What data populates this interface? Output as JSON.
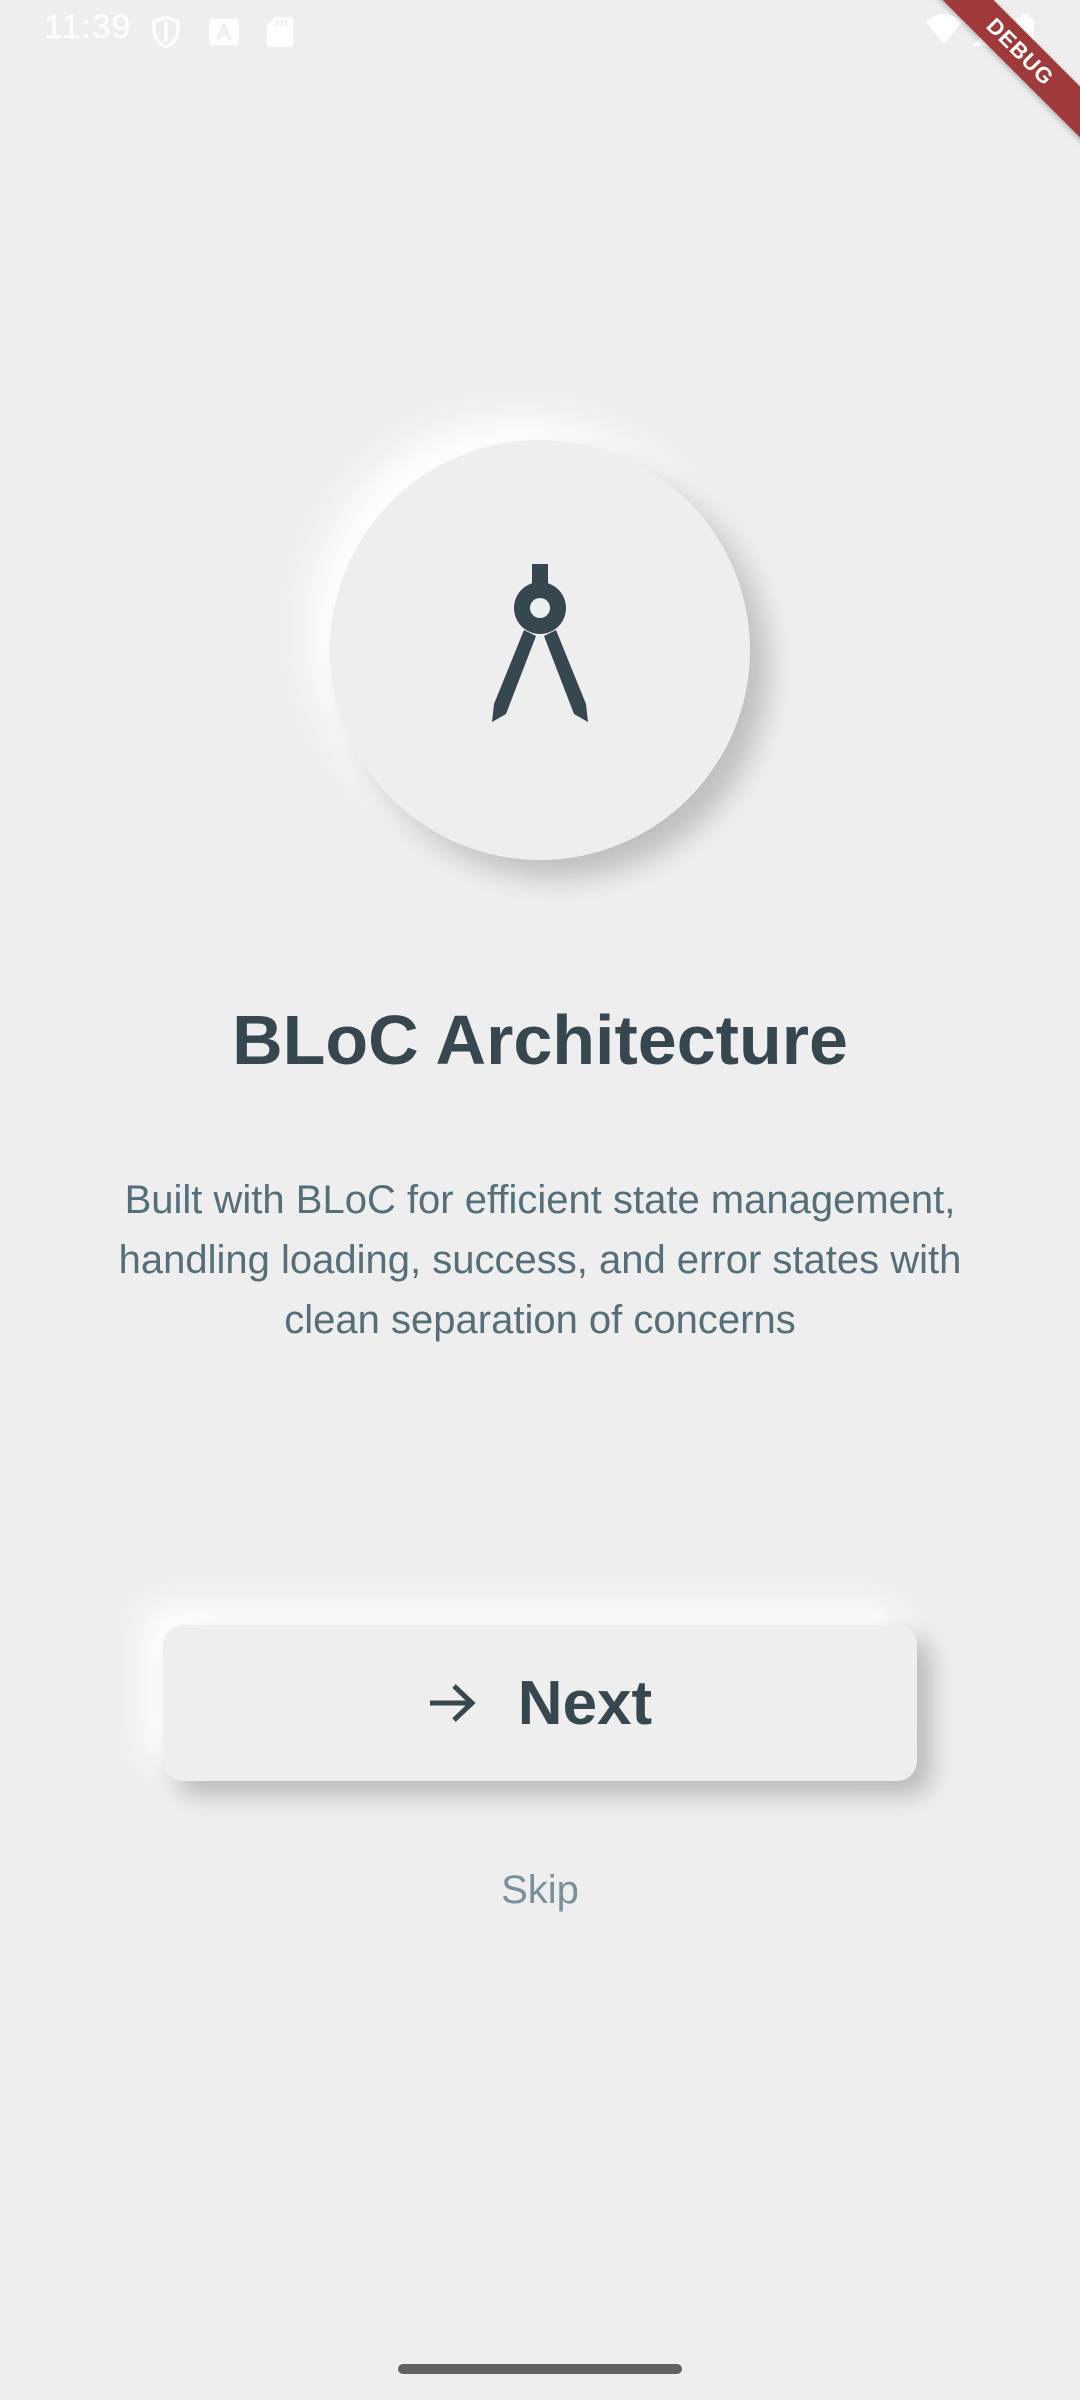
{
  "status_bar": {
    "time": "11:39",
    "left_icons": [
      "shield-icon",
      "a-icon",
      "sd-card-icon"
    ],
    "right_icons": [
      "wifi-icon",
      "signal-icon",
      "battery-icon"
    ]
  },
  "debug_banner": {
    "label": "DEBUG",
    "color": "#a03a3a"
  },
  "hero": {
    "icon": "compass-icon",
    "icon_color": "#37474f"
  },
  "title": "BLoC Architecture",
  "description": "Built with BLoC for efficient state management, handling loading, success, and error states with clean separation of concerns",
  "next_button": {
    "icon": "arrow-forward-icon",
    "label": "Next"
  },
  "skip_label": "Skip",
  "colors": {
    "background": "#eeeeee",
    "primary_text": "#37474f",
    "secondary_text": "#546e7a",
    "muted_text": "#78909c"
  }
}
